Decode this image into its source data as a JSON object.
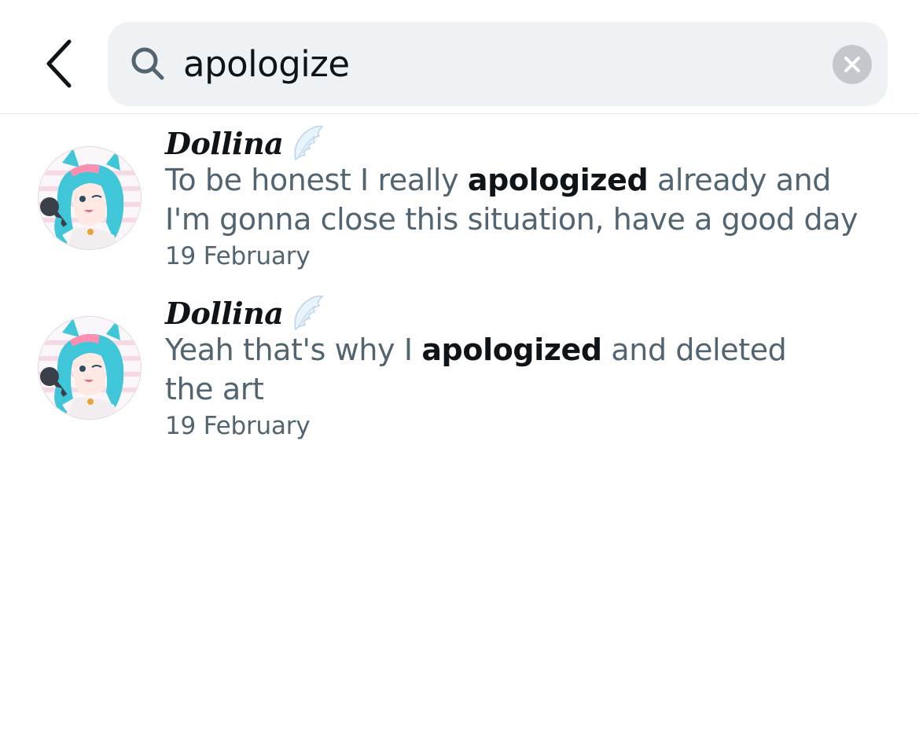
{
  "header": {
    "back_icon": "chevron-left-icon",
    "search": {
      "icon": "search-icon",
      "value": "apologize",
      "clear_icon": "clear-icon"
    }
  },
  "results": [
    {
      "name": "Dollina",
      "emoji_icon": "wing-icon",
      "text_before": "To be honest I really ",
      "highlight": "apologized",
      "text_after_1": " already and",
      "text_after_2": "I'm gonna close this situation, have a good day",
      "date": "19 February"
    },
    {
      "name": "Dollina",
      "emoji_icon": "wing-icon",
      "text_before": "Yeah that's why I ",
      "highlight": "apologized",
      "text_after_1": " and deleted",
      "text_after_2": "the art",
      "date": "19 February"
    }
  ],
  "colors": {
    "primary_text": "#0f1419",
    "secondary_text": "#536471",
    "search_bg": "#eff2f5",
    "clear_bg": "#c4c8cc"
  }
}
